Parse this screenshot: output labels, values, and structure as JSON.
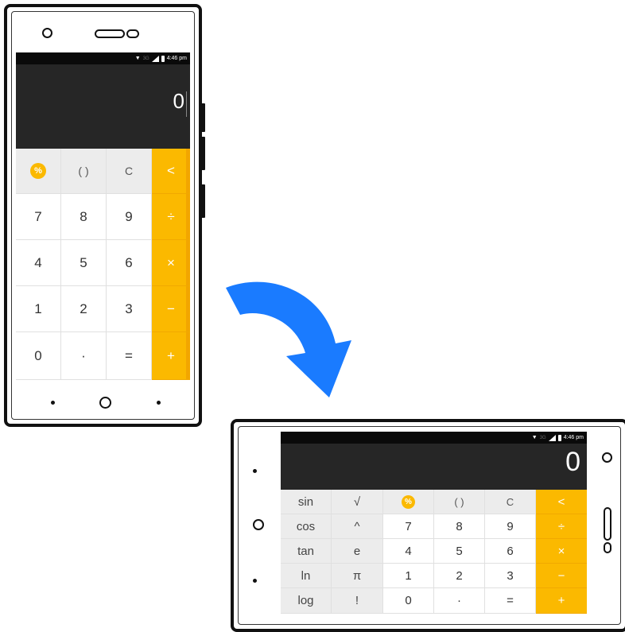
{
  "status_bar": {
    "time": "4:46 pm",
    "network": "3G"
  },
  "portrait": {
    "display": "0",
    "keys": [
      {
        "label": "%",
        "kind": "pct"
      },
      {
        "label": "( )",
        "kind": "top"
      },
      {
        "label": "C",
        "kind": "top"
      },
      {
        "label": "<",
        "kind": "op"
      },
      {
        "label": "7",
        "kind": "num"
      },
      {
        "label": "8",
        "kind": "num"
      },
      {
        "label": "9",
        "kind": "num"
      },
      {
        "label": "÷",
        "kind": "op"
      },
      {
        "label": "4",
        "kind": "num"
      },
      {
        "label": "5",
        "kind": "num"
      },
      {
        "label": "6",
        "kind": "num"
      },
      {
        "label": "×",
        "kind": "op"
      },
      {
        "label": "1",
        "kind": "num"
      },
      {
        "label": "2",
        "kind": "num"
      },
      {
        "label": "3",
        "kind": "num"
      },
      {
        "label": "−",
        "kind": "op"
      },
      {
        "label": "0",
        "kind": "num"
      },
      {
        "label": "·",
        "kind": "num"
      },
      {
        "label": "=",
        "kind": "num"
      },
      {
        "label": "+",
        "kind": "op"
      }
    ]
  },
  "landscape": {
    "display": "0",
    "keys": [
      {
        "label": "sin",
        "kind": "sci"
      },
      {
        "label": "√",
        "kind": "sci"
      },
      {
        "label": "%",
        "kind": "pct"
      },
      {
        "label": "( )",
        "kind": "top"
      },
      {
        "label": "C",
        "kind": "top"
      },
      {
        "label": "<",
        "kind": "op"
      },
      {
        "label": "cos",
        "kind": "sci"
      },
      {
        "label": "^",
        "kind": "sci"
      },
      {
        "label": "7",
        "kind": "num"
      },
      {
        "label": "8",
        "kind": "num"
      },
      {
        "label": "9",
        "kind": "num"
      },
      {
        "label": "÷",
        "kind": "op"
      },
      {
        "label": "tan",
        "kind": "sci"
      },
      {
        "label": "e",
        "kind": "sci"
      },
      {
        "label": "4",
        "kind": "num"
      },
      {
        "label": "5",
        "kind": "num"
      },
      {
        "label": "6",
        "kind": "num"
      },
      {
        "label": "×",
        "kind": "op"
      },
      {
        "label": "ln",
        "kind": "sci"
      },
      {
        "label": "π",
        "kind": "sci"
      },
      {
        "label": "1",
        "kind": "num"
      },
      {
        "label": "2",
        "kind": "num"
      },
      {
        "label": "3",
        "kind": "num"
      },
      {
        "label": "−",
        "kind": "op"
      },
      {
        "label": "log",
        "kind": "sci"
      },
      {
        "label": "!",
        "kind": "sci"
      },
      {
        "label": "0",
        "kind": "num"
      },
      {
        "label": "·",
        "kind": "num"
      },
      {
        "label": "=",
        "kind": "num"
      },
      {
        "label": "+",
        "kind": "op"
      }
    ]
  },
  "colors": {
    "accent": "#fbb900",
    "display_bg": "#262626",
    "rotate_arrow": "#1a7bff"
  },
  "icons": {
    "rotate_arrow": "curved-arrow-icon"
  }
}
